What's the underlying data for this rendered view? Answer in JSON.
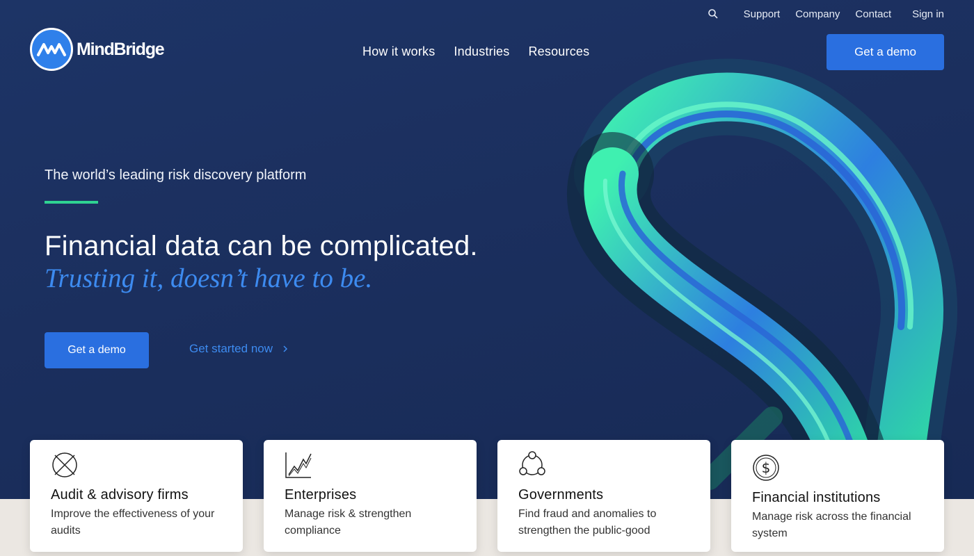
{
  "brand": {
    "name": "MindBridge"
  },
  "utility_nav": {
    "items": [
      "Support",
      "Company",
      "Contact"
    ],
    "sign_in": "Sign in"
  },
  "main_nav": {
    "items": [
      "How it works",
      "Industries",
      "Resources"
    ]
  },
  "header_cta": "Get a demo",
  "hero": {
    "eyebrow": "The world’s leading risk discovery platform",
    "headline": "Financial data can be complicated.",
    "subhead": "Trusting it, doesn’t have to be.",
    "primary_cta": "Get a demo",
    "secondary_cta": "Get started now"
  },
  "cards": [
    {
      "icon": "target-circle-icon",
      "title": "Audit & advisory firms",
      "description": "Improve the effectiveness of your audits"
    },
    {
      "icon": "line-chart-icon",
      "title": "Enterprises",
      "description": "Manage risk & strengthen compliance"
    },
    {
      "icon": "network-nodes-icon",
      "title": "Governments",
      "description": "Find fraud and anomalies to strengthen the public-good"
    },
    {
      "icon": "dollar-coin-icon",
      "title": "Financial institutions",
      "description": "Manage risk across the financial system"
    }
  ],
  "colors": {
    "hero_background": "#1b2f5e",
    "accent_blue": "#2a6fe0",
    "accent_green": "#2fd392",
    "link_blue": "#3d8bf0"
  }
}
